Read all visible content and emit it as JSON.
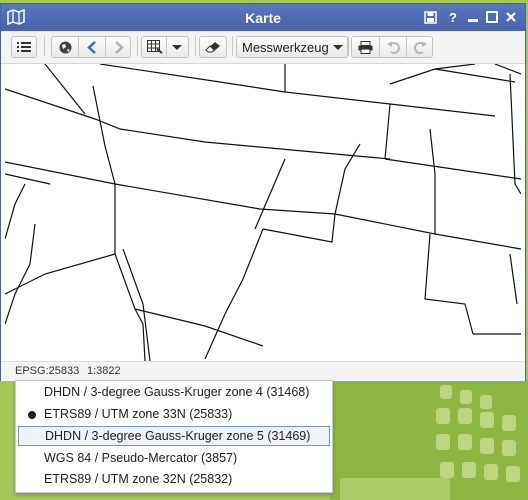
{
  "window": {
    "title": "Karte"
  },
  "toolbar": {
    "measure_tool_label": "Messwerkzeug"
  },
  "status": {
    "epsg": "EPSG:25833",
    "scale": "1:3822"
  },
  "crs_options": [
    {
      "label": "DHDN / 3-degree Gauss-Kruger zone 4 (31468)",
      "selected": false,
      "hover": false
    },
    {
      "label": "ETRS89 / UTM zone 33N (25833)",
      "selected": true,
      "hover": false
    },
    {
      "label": "DHDN / 3-degree Gauss-Kruger zone 5 (31469)",
      "selected": false,
      "hover": true
    },
    {
      "label": "WGS 84 / Pseudo-Mercator (3857)",
      "selected": false,
      "hover": false
    },
    {
      "label": "ETRS89 / UTM zone 32N (25832)",
      "selected": false,
      "hover": false
    }
  ],
  "colors": {
    "titlebar": "#4f6bb3",
    "background": "#9cbf4a"
  }
}
